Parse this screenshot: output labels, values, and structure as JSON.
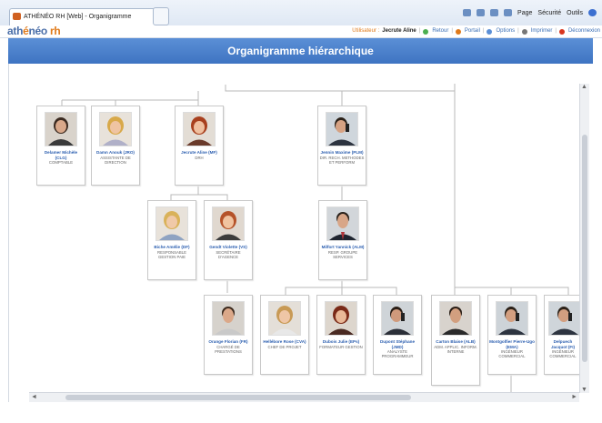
{
  "browser": {
    "tab_title": "ATHÉNÉO RH [Web] - Organigramme hiérarchique",
    "commands": [
      "Page",
      "Sécurité",
      "Outils"
    ]
  },
  "app": {
    "logo_main": "ath",
    "logo_accent": "é",
    "logo_rest": "néo",
    "logo_rh": "rh",
    "user_label": "Utilisateur :",
    "user_name": "Jecrute Aline",
    "links": [
      "Retour",
      "Portail",
      "Options",
      "Imprimer",
      "Déconnexion"
    ],
    "page_title": "Organigramme hiérarchique"
  },
  "colors": {
    "banner": "#4a7fcc",
    "name": "#2c5fb0",
    "accent": "#e07a1a"
  },
  "org": [
    {
      "id": "clg",
      "name": "Delamer Michèle (CLG)",
      "role": "COMPTABLE",
      "photo": "woman-dark"
    },
    {
      "id": "jro",
      "name": "Damn Anouk (JRO)",
      "role": "ASSISTANTE DE DIRECTION",
      "photo": "woman-blond"
    },
    {
      "id": "mf",
      "name": "Jecrute Aline (MF)",
      "role": "DRH",
      "photo": "woman-red"
    },
    {
      "id": "plm",
      "name": "Jennin Maxime (PLM)",
      "role": "DIR. RECH. METHODES ET PERFORM",
      "photo": "man-phone"
    },
    {
      "id": "df",
      "name": "Biche Amélie (DF)",
      "role": "RESPONSABLE GESTION PAIE",
      "photo": "woman-blond"
    },
    {
      "id": "vs",
      "name": "Gendt Violette (VS)",
      "role": "SECRÉTAIRE D'AGENCE",
      "photo": "woman-red"
    },
    {
      "id": "alm",
      "name": "Milfort Yannick (ALM)",
      "role": "RESP. GROUPE SERVICES",
      "photo": "man-suit"
    },
    {
      "id": "fr",
      "name": "Orange Florian (FR)",
      "role": "CHARGÉ DE PRESTATIONS",
      "photo": "man-young"
    },
    {
      "id": "cva",
      "name": "Hellébore Rose (CVA)",
      "role": "CHEF DE PROJET",
      "photo": "woman-blond"
    },
    {
      "id": "eps",
      "name": "Dubois Julie (EPs)",
      "role": "FORMATEUR GESTION",
      "photo": "woman-red"
    },
    {
      "id": "jmd",
      "name": "Dupont Stéphane (JMD)",
      "role": "ANALYSTE PROGRAMMEUR",
      "photo": "man-phone"
    },
    {
      "id": "alb",
      "name": "Carton Blaise (ALB)",
      "role": "ADM. APPLIC. INFORM. INTERNE",
      "photo": "man-smile"
    },
    {
      "id": "ema",
      "name": "Montgolfier Pierre-Ugo (EMA)",
      "role": "INGÉNIEUR COMMERCIAL",
      "photo": "man-phone"
    },
    {
      "id": "fi",
      "name": "Delpuech Jacquot (FI)",
      "role": "INGÉNIEUR COMMERCIAL",
      "photo": "man-phone"
    }
  ]
}
